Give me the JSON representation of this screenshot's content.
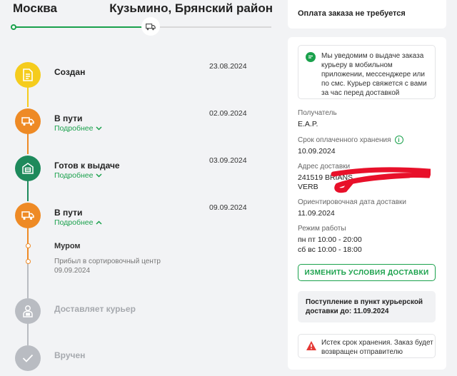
{
  "header": {
    "from_city": "Москва",
    "to_city": "Кузьмино, Брянский район"
  },
  "colors": {
    "accent": "#1aa14c",
    "yellow": "#f5cc1d",
    "orange": "#ee8a25",
    "dark_green": "#1e8a5c",
    "muted": "#b9bcc2",
    "warning": "#e53935",
    "redaction": "#e8102a"
  },
  "timeline": {
    "steps": [
      {
        "title": "Создан",
        "date": "23.08.2024",
        "icon": "document-icon"
      },
      {
        "title": "В пути",
        "date": "02.09.2024",
        "more": "Подробнее",
        "icon": "truck-icon"
      },
      {
        "title": "Готов к выдаче",
        "date": "03.09.2024",
        "more": "Подробнее",
        "icon": "pickup-point-icon"
      },
      {
        "title": "В пути",
        "date": "09.09.2024",
        "more": "Подробнее",
        "icon": "truck-icon",
        "expanded": true
      },
      {
        "title": "Доставляет курьер",
        "icon": "courier-icon"
      },
      {
        "title": "Вручен",
        "icon": "check-icon"
      }
    ],
    "substep": {
      "title": "Муром",
      "description": "Прибыл в сортировочный центр",
      "date": "09.09.2024"
    }
  },
  "payment": {
    "status": "Оплата заказа не требуется"
  },
  "info": {
    "notice": "Мы уведомим о выдаче заказа курьеру в мобильном приложении, мессенджере или по смс. Курьер свяжется с вами за час перед доставкой",
    "recipient_label": "Получатель",
    "recipient_value": "E.A.P.",
    "storage_label": "Срок оплаченного хранения",
    "storage_value": "10.09.2024",
    "address_label": "Адрес доставки",
    "address_line1": "241519 BRIANS",
    "address_line2": "VERB",
    "eta_label": "Ориентировочная дата доставки",
    "eta_value": "11.09.2024",
    "hours_label": "Режим работы",
    "hours_line1": "пн пт 10:00 - 20:00",
    "hours_line2": "сб вс 10:00 - 18:00",
    "change_button": "ИЗМЕНИТЬ УСЛОВИЯ ДОСТАВКИ",
    "arrival": "Поступление в пункт курьерской доставки до: 11.09.2024",
    "expire": "Истек срок хранения. Заказ будет возвращен отправителю"
  }
}
